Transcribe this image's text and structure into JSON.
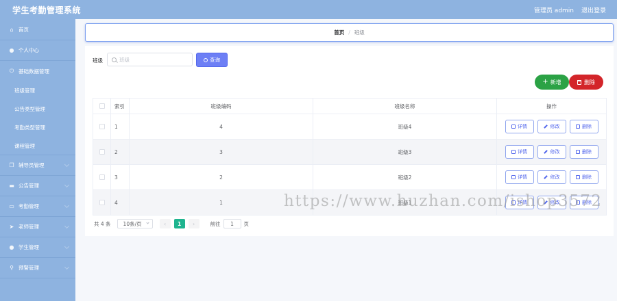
{
  "header": {
    "title": "学生考勤管理系统",
    "user": "管理员 admin",
    "logout": "退出登录"
  },
  "sidebar": {
    "items": [
      {
        "label": "首页",
        "icon": "home-icon"
      },
      {
        "label": "个人中心",
        "icon": "user-icon"
      },
      {
        "label": "基础数据管理",
        "icon": "power-icon"
      },
      {
        "label": "辅导员管理",
        "icon": "copy-icon"
      },
      {
        "label": "公告管理",
        "icon": "monitor-icon"
      },
      {
        "label": "考勤管理",
        "icon": "card-icon"
      },
      {
        "label": "老师管理",
        "icon": "send-icon"
      },
      {
        "label": "学生管理",
        "icon": "user-icon"
      },
      {
        "label": "预警管理",
        "icon": "location-icon"
      }
    ],
    "sub_items": [
      "班级管理",
      "公告类型管理",
      "考勤类型管理",
      "课程管理"
    ]
  },
  "breadcrumb": {
    "home": "首页",
    "separator": "/",
    "current": "班级"
  },
  "search": {
    "label": "班级",
    "placeholder": "班级",
    "button": "查询"
  },
  "actions": {
    "add": "新增",
    "delete": "删除"
  },
  "table": {
    "headers": {
      "index": "索引",
      "code": "班级编码",
      "name": "班级名称",
      "ops": "操作"
    },
    "rows": [
      {
        "index": "1",
        "code": "4",
        "name": "班级4"
      },
      {
        "index": "2",
        "code": "3",
        "name": "班级3"
      },
      {
        "index": "3",
        "code": "2",
        "name": "班级2"
      },
      {
        "index": "4",
        "code": "1",
        "name": "班级1"
      }
    ],
    "row_actions": {
      "detail": "详情",
      "edit": "修改",
      "delete": "删除"
    }
  },
  "pagination": {
    "total": "共 4 条",
    "page_size": "10条/页",
    "prev": "‹",
    "current_page": "1",
    "next": "›",
    "goto_label": "前往",
    "goto_value": "1",
    "goto_suffix": "页"
  },
  "watermark": "https://www.huzhan.com/ishop3572",
  "colors": {
    "sidebar": "#8eb3e0",
    "primary": "#6d7ff5",
    "success": "#2ba245",
    "danger": "#d3252a",
    "page_active": "#1fb48f"
  }
}
